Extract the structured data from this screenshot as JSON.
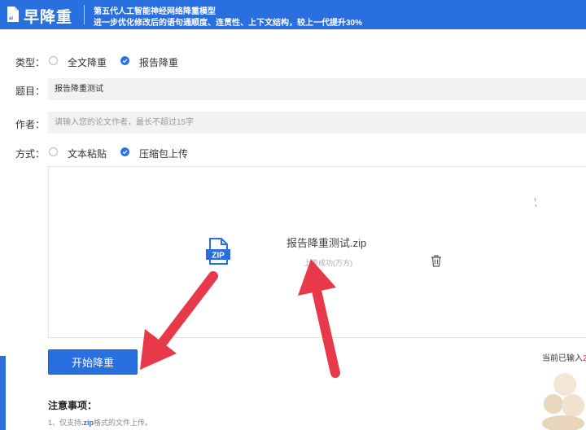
{
  "header": {
    "app_name": "早降重",
    "tagline_1": "第五代人工智能神经网络降重模型",
    "tagline_2": "进一步优化修改后的语句通顺度、连贯性、上下文结构，较上一代提升30%",
    "bg_color": "#2a6fe0"
  },
  "form": {
    "type_label": "类型：",
    "type_options": [
      {
        "label": "全文降重",
        "checked": false
      },
      {
        "label": "报告降重",
        "checked": true
      }
    ],
    "title_label": "题目：",
    "title_value": "报告降重测试",
    "author_label": "作者：",
    "author_placeholder": "请输入您的论文作者，最长不超过15字",
    "method_label": "方式：",
    "method_options": [
      {
        "label": "文本粘贴",
        "checked": false
      },
      {
        "label": "压缩包上传",
        "checked": true
      }
    ]
  },
  "upload": {
    "file_icon": "zip-file-icon",
    "file_icon_text": "ZIP",
    "file_name": "报告降重测试.zip",
    "status": "上传成功(万方)",
    "delete_icon": "trash-icon"
  },
  "actions": {
    "start_label": "开始降重",
    "word_count_prefix": "当前已输入",
    "word_count_value": "2"
  },
  "notes": {
    "title": "注意事项：",
    "item_1_prefix": "1、仅支持",
    "item_1_highlight": ".zip",
    "item_1_suffix": "格式的文件上传。"
  },
  "annotations": {
    "arrow_color": "#e8394a"
  }
}
